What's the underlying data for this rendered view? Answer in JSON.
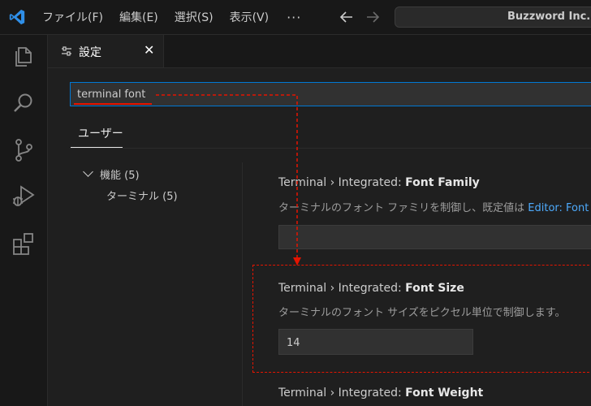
{
  "menu": {
    "items": [
      "ファイル(F)",
      "編集(E)",
      "選択(S)",
      "表示(V)"
    ],
    "more": "···"
  },
  "title_search": {
    "label": "Buzzword Inc."
  },
  "tab": {
    "label": "設定",
    "close": "✕"
  },
  "settings": {
    "search_value": "terminal font",
    "scope_tab": "ユーザー",
    "toc": {
      "group": "機能 (5)",
      "child": "ターミナル (5)"
    },
    "items": [
      {
        "prefix": "Terminal › Integrated: ",
        "name": "Font Family",
        "description": "ターミナルのフォント ファミリを制御し、既定値は ",
        "link": "Editor: Font Fa"
      },
      {
        "prefix": "Terminal › Integrated: ",
        "name": "Font Size",
        "description": "ターミナルのフォント サイズをピクセル単位で制御します。",
        "value": "14"
      },
      {
        "prefix": "Terminal › Integrated: ",
        "name": "Font Weight"
      }
    ]
  },
  "colors": {
    "accent": "#0078d4",
    "annotation": "#e51400",
    "link": "#4daafc"
  },
  "icons": [
    "vscode-logo-icon",
    "explorer-icon",
    "search-icon",
    "source-control-icon",
    "run-debug-icon",
    "extensions-icon",
    "settings-sliders-icon",
    "arrow-left-icon",
    "arrow-right-icon"
  ]
}
